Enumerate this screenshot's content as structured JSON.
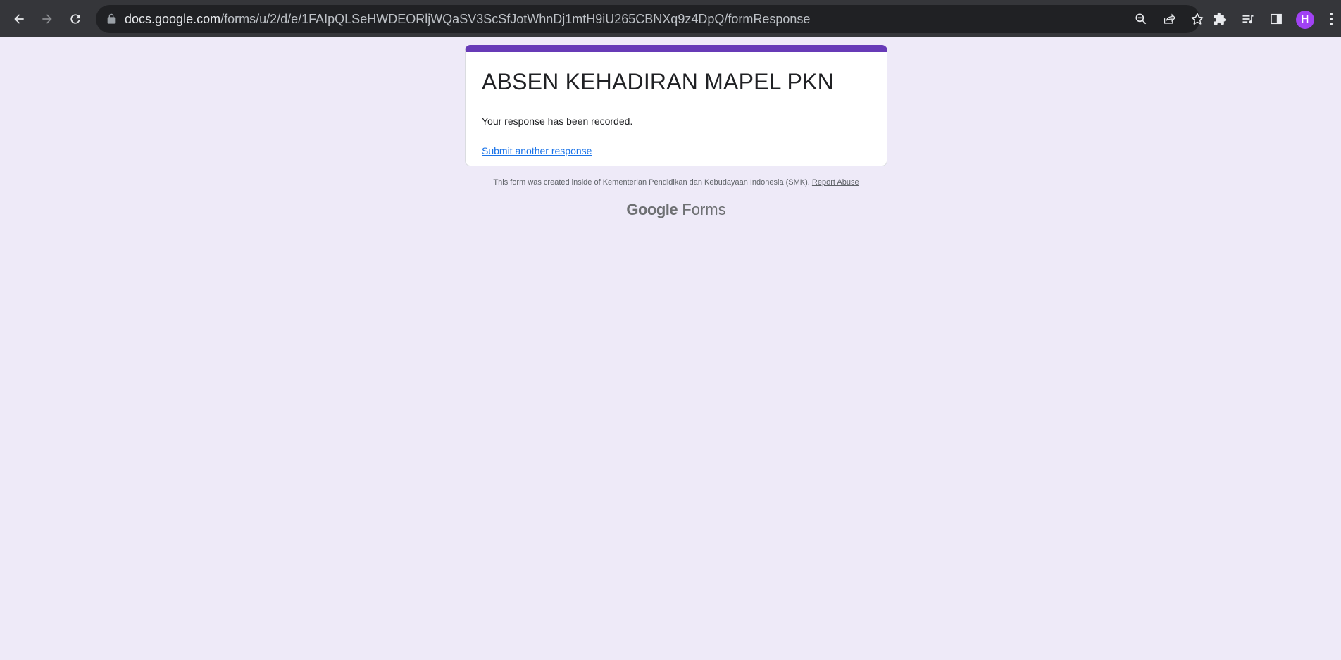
{
  "browser": {
    "url_host": "docs.google.com",
    "url_path": "/forms/u/2/d/e/1FAIpQLSeHWDEORljWQaSV3ScSfJotWhnDj1mtH9iU265CBNXq9z4DpQ/formResponse",
    "profile_initial": "H",
    "icons": {
      "back": "back-arrow-icon",
      "forward": "forward-arrow-icon",
      "reload": "reload-icon",
      "lock": "lock-icon",
      "zoom": "zoom-icon",
      "share": "share-icon",
      "bookmark": "star-icon",
      "extensions": "puzzle-icon",
      "media": "media-queue-icon",
      "side_panel": "side-panel-icon",
      "menu": "kebab-menu-icon"
    },
    "colors": {
      "toolbar": "#35363a",
      "omnibox": "#202124",
      "avatar": "#a142f4"
    }
  },
  "form": {
    "title": "ABSEN KEHADIRAN MAPEL PKN",
    "confirmation": "Your response has been recorded.",
    "submit_another": "Submit another response",
    "accent_color": "#673ab7",
    "background_color": "#eeeaf8"
  },
  "footer": {
    "created_text": "This form was created inside of Kementerian Pendidikan dan Kebudayaan Indonesia (SMK).",
    "report_abuse": "Report Abuse"
  },
  "brand": {
    "google": "Google",
    "forms": "Forms"
  }
}
